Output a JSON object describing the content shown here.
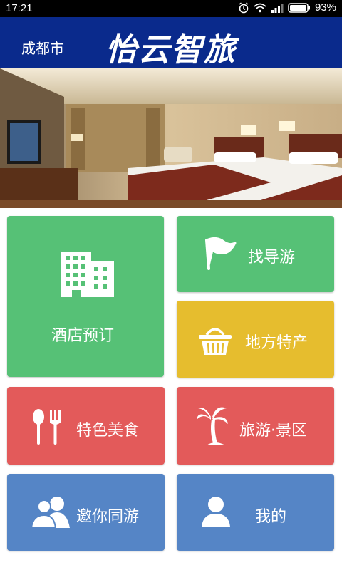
{
  "status_bar": {
    "time": "17:21",
    "battery": "93%"
  },
  "header": {
    "city": "成都市",
    "brand": "怡云智旅"
  },
  "tiles": {
    "hotel": {
      "label": "酒店预订",
      "icon": "building-icon",
      "color": "#56c176"
    },
    "guide": {
      "label": "找导游",
      "icon": "flag-icon",
      "color": "#56c176"
    },
    "local": {
      "label": "地方特产",
      "icon": "basket-icon",
      "color": "#e6bd2e"
    },
    "food": {
      "label": "特色美食",
      "icon": "utensils-icon",
      "color": "#e35a5a"
    },
    "scenic": {
      "label": "旅游·景区",
      "icon": "palm-tree-icon",
      "color": "#e35a5a"
    },
    "invite": {
      "label": "邀你同游",
      "icon": "people-icon",
      "color": "#5585c6"
    },
    "mine": {
      "label": "我的",
      "icon": "user-icon",
      "color": "#5585c6"
    }
  },
  "colors": {
    "header_bg": "#0a2a8c",
    "green": "#56c176",
    "yellow": "#e6bd2e",
    "red": "#e35a5a",
    "blue": "#5585c6"
  }
}
